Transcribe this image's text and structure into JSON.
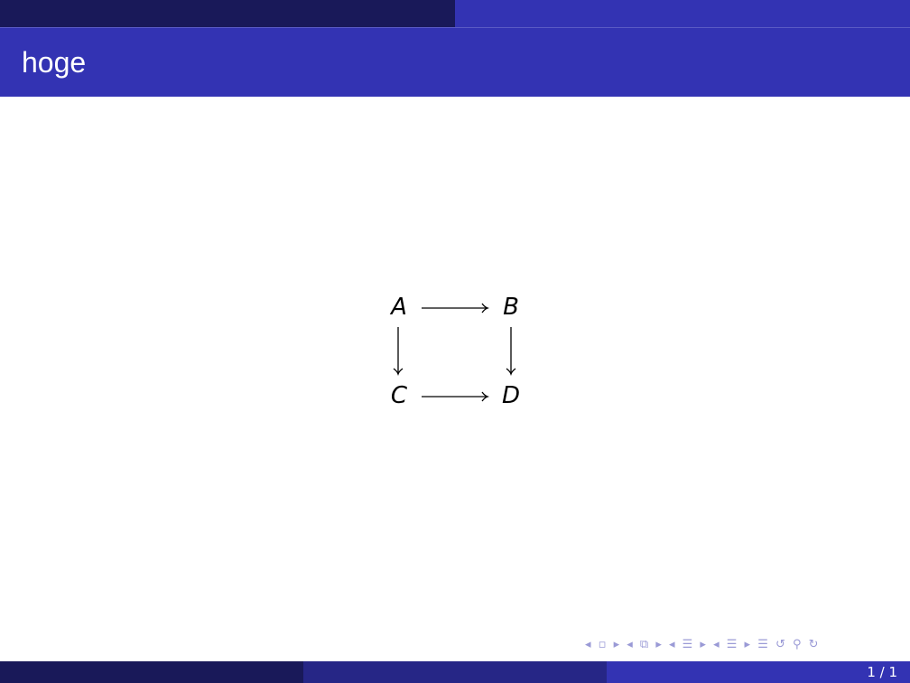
{
  "slide": {
    "title": "hoge",
    "page": "1 / 1"
  },
  "diagram": {
    "nodes": {
      "a": "A",
      "b": "B",
      "c": "C",
      "d": "D"
    }
  },
  "nav": {
    "symbols": "◂ ▫ ▸  ◂ ⧉ ▸  ◂ ☰ ▸  ◂ ☰ ▸    ☰    ↺ ⚲ ↻"
  },
  "colors": {
    "dark": "#191959",
    "blue": "#3333b3",
    "mid": "#262686"
  }
}
